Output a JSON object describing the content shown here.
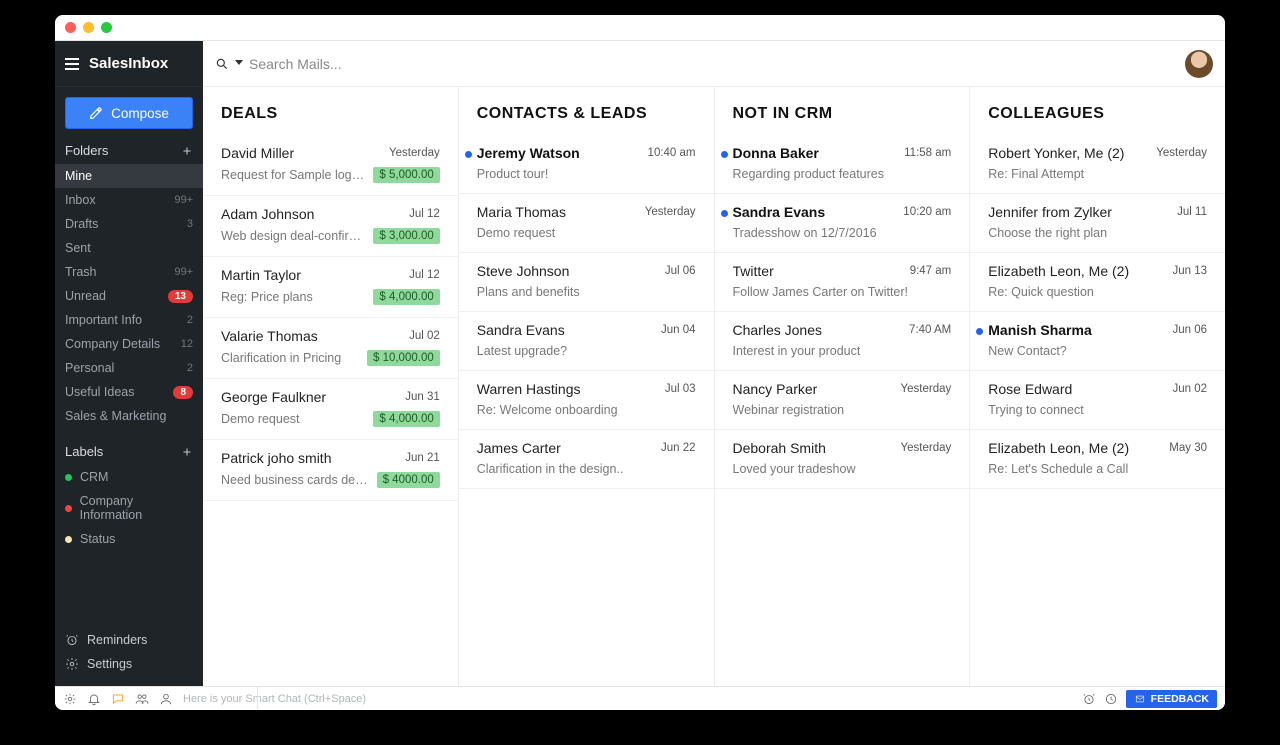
{
  "brand": "SalesInbox",
  "compose_label": "Compose",
  "search": {
    "placeholder": "Search Mails..."
  },
  "folders_header": "Folders",
  "folders": [
    {
      "name": "Mine",
      "count": "",
      "active": true
    },
    {
      "name": "Inbox",
      "count": "99+",
      "badge": false
    },
    {
      "name": "Drafts",
      "count": "3",
      "badge": false
    },
    {
      "name": "Sent",
      "count": "",
      "badge": false
    },
    {
      "name": "Trash",
      "count": "99+",
      "badge": false
    },
    {
      "name": "Unread",
      "count": "13",
      "badge": true
    },
    {
      "name": "Important Info",
      "count": "2",
      "badge": false
    },
    {
      "name": "Company Details",
      "count": "12",
      "badge": false
    },
    {
      "name": "Personal",
      "count": "2",
      "badge": false
    },
    {
      "name": "Useful Ideas",
      "count": "8",
      "badge": true
    },
    {
      "name": "Sales & Marketing",
      "count": "",
      "badge": false
    }
  ],
  "labels_header": "Labels",
  "labels": [
    {
      "name": "CRM",
      "color": "#22c55e"
    },
    {
      "name": "Company Information",
      "color": "#ef4444"
    },
    {
      "name": "Status",
      "color": "#f5e6b3"
    }
  ],
  "sidebar_bottom": {
    "reminders": "Reminders",
    "settings": "Settings"
  },
  "status_hint": "Here is your Smart Chat (Ctrl+Space)",
  "feedback_label": "FEEDBACK",
  "columns": [
    {
      "title": "DEALS",
      "mails": [
        {
          "sender": "David Miller",
          "time": "Yesterday",
          "subject": "Request for Sample logo…",
          "deal": "$ 5,000.00",
          "unread": false
        },
        {
          "sender": "Adam Johnson",
          "time": "Jul 12",
          "subject": "Web design deal-confirma…",
          "deal": "$ 3,000.00",
          "unread": false
        },
        {
          "sender": "Martin Taylor",
          "time": "Jul 12",
          "subject": "Reg: Price plans",
          "deal": "$ 4,000.00",
          "unread": false
        },
        {
          "sender": "Valarie Thomas",
          "time": "Jul 02",
          "subject": "Clarification in Pricing",
          "deal": "$ 10,000.00",
          "unread": false
        },
        {
          "sender": "George Faulkner",
          "time": "Jun 31",
          "subject": "Demo request",
          "deal": "$ 4,000.00",
          "unread": false
        },
        {
          "sender": "Patrick joho smith",
          "time": "Jun 21",
          "subject": "Need business cards desi…",
          "deal": "$ 4000.00",
          "unread": false
        }
      ]
    },
    {
      "title": "CONTACTS & LEADS",
      "mails": [
        {
          "sender": "Jeremy Watson",
          "time": "10:40 am",
          "subject": "Product tour!",
          "unread": true
        },
        {
          "sender": "Maria Thomas",
          "time": "Yesterday",
          "subject": "Demo request",
          "unread": false
        },
        {
          "sender": "Steve Johnson",
          "time": "Jul 06",
          "subject": "Plans and benefits",
          "unread": false
        },
        {
          "sender": "Sandra Evans",
          "time": "Jun 04",
          "subject": "Latest upgrade?",
          "unread": false
        },
        {
          "sender": "Warren Hastings",
          "time": "Jul 03",
          "subject": "Re: Welcome onboarding",
          "unread": false
        },
        {
          "sender": "James Carter",
          "time": "Jun 22",
          "subject": "Clarification in the design..",
          "unread": false
        }
      ]
    },
    {
      "title": "NOT IN CRM",
      "mails": [
        {
          "sender": "Donna Baker",
          "time": "11:58 am",
          "subject": "Regarding product features",
          "unread": true
        },
        {
          "sender": "Sandra Evans",
          "time": "10:20 am",
          "subject": "Tradesshow on 12/7/2016",
          "unread": true
        },
        {
          "sender": "Twitter",
          "time": "9:47 am",
          "subject": "Follow James Carter on Twitter!",
          "unread": false
        },
        {
          "sender": "Charles Jones",
          "time": "7:40 AM",
          "subject": "Interest in your product",
          "unread": false
        },
        {
          "sender": "Nancy Parker",
          "time": "Yesterday",
          "subject": "Webinar registration",
          "unread": false
        },
        {
          "sender": "Deborah Smith",
          "time": "Yesterday",
          "subject": "Loved your tradeshow",
          "unread": false
        }
      ]
    },
    {
      "title": "COLLEAGUES",
      "mails": [
        {
          "sender": "Robert Yonker, Me (2)",
          "time": "Yesterday",
          "subject": "Re: Final Attempt",
          "unread": false
        },
        {
          "sender": "Jennifer from Zylker",
          "time": "Jul 11",
          "subject": "Choose the right plan",
          "unread": false
        },
        {
          "sender": "Elizabeth Leon, Me (2)",
          "time": "Jun 13",
          "subject": "Re: Quick question",
          "unread": false
        },
        {
          "sender": "Manish Sharma",
          "time": "Jun 06",
          "subject": "New Contact?",
          "unread": true
        },
        {
          "sender": "Rose Edward",
          "time": "Jun 02",
          "subject": "Trying to connect",
          "unread": false
        },
        {
          "sender": "Elizabeth Leon, Me (2)",
          "time": "May 30",
          "subject": "Re: Let's Schedule a Call",
          "unread": false
        }
      ]
    }
  ]
}
